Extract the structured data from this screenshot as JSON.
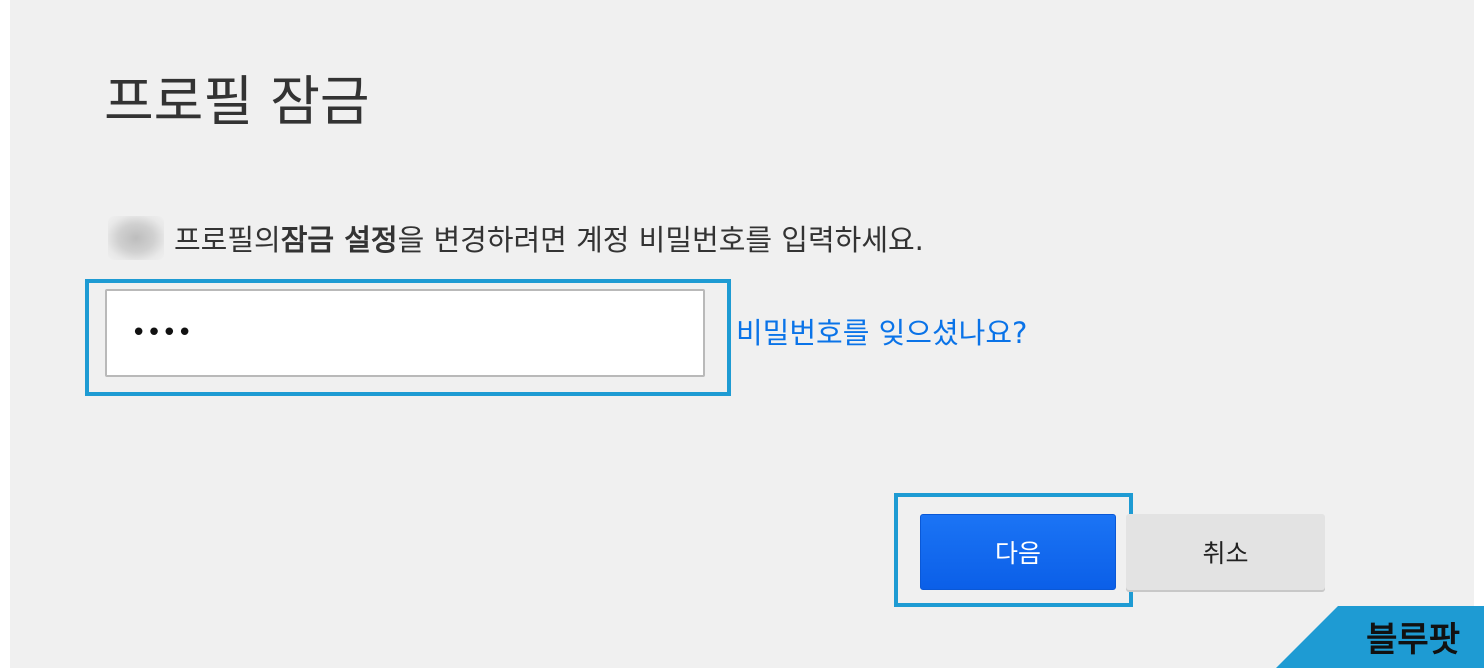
{
  "dialog": {
    "title": "프로필 잠금",
    "description_prefix": "프로필의 ",
    "description_bold": "잠금 설정",
    "description_suffix": "을 변경하려면 계정 비밀번호를 입력하세요."
  },
  "password": {
    "value_display": "••••"
  },
  "links": {
    "forgot_password": "비밀번호를 잊으셨나요?"
  },
  "buttons": {
    "next": "다음",
    "cancel": "취소"
  },
  "watermark": {
    "text": "블루팟"
  },
  "colors": {
    "panel_background": "#f0f0f0",
    "highlight_border": "#1e9bd3",
    "primary_button": "#0b5fe8",
    "link": "#0a73e8",
    "watermark_background": "#1e9bd3"
  }
}
